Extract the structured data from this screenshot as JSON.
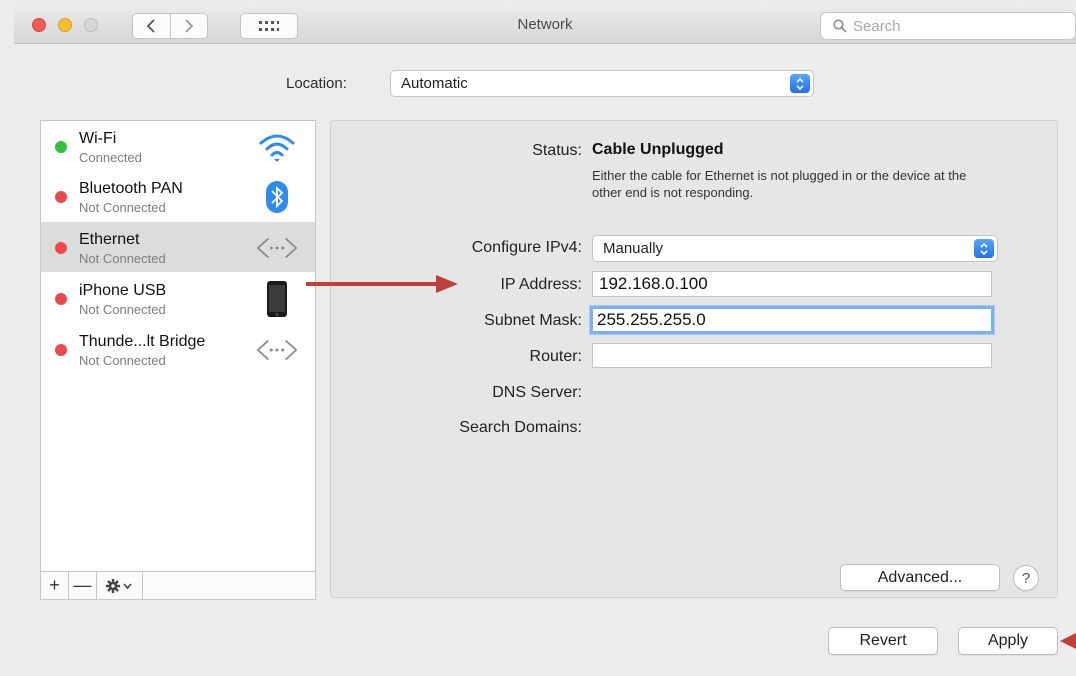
{
  "window": {
    "title": "Network",
    "search_placeholder": "Search"
  },
  "location": {
    "label": "Location:",
    "value": "Automatic"
  },
  "services": [
    {
      "name": "Wi-Fi",
      "status": "Connected",
      "status_color": "#33c03f",
      "icon": "wifi-icon",
      "selected": false
    },
    {
      "name": "Bluetooth PAN",
      "status": "Not Connected",
      "status_color": "#ec4a4a",
      "icon": "bluetooth-icon",
      "selected": false
    },
    {
      "name": "Ethernet",
      "status": "Not Connected",
      "status_color": "#ec4a4a",
      "icon": "ethernet-icon",
      "selected": true
    },
    {
      "name": "iPhone USB",
      "status": "Not Connected",
      "status_color": "#ec4a4a",
      "icon": "iphone-icon",
      "selected": false
    },
    {
      "name": "Thunde...lt Bridge",
      "status": "Not Connected",
      "status_color": "#ec4a4a",
      "icon": "thunderbolt-bridge-icon",
      "selected": false
    }
  ],
  "sidebar_toolbar": {
    "add": "+",
    "remove": "—"
  },
  "detail": {
    "status_label": "Status:",
    "status_value": "Cable Unplugged",
    "status_description": "Either the cable for Ethernet is not plugged in or the device at the other end is not responding.",
    "configure_label": "Configure IPv4:",
    "configure_value": "Manually",
    "ip_label": "IP Address:",
    "ip_value": "192.168.0.100",
    "subnet_label": "Subnet Mask:",
    "subnet_value": "255.255.255.0",
    "router_label": "Router:",
    "router_value": "",
    "dns_label": "DNS Server:",
    "search_domains_label": "Search Domains:"
  },
  "buttons": {
    "advanced": "Advanced...",
    "help": "?",
    "revert": "Revert",
    "apply": "Apply"
  },
  "colors": {
    "accent": "#1d72e8",
    "annotation_arrow": "#c0403c",
    "connected": "#33c03f",
    "not_connected": "#ec4a4a"
  }
}
